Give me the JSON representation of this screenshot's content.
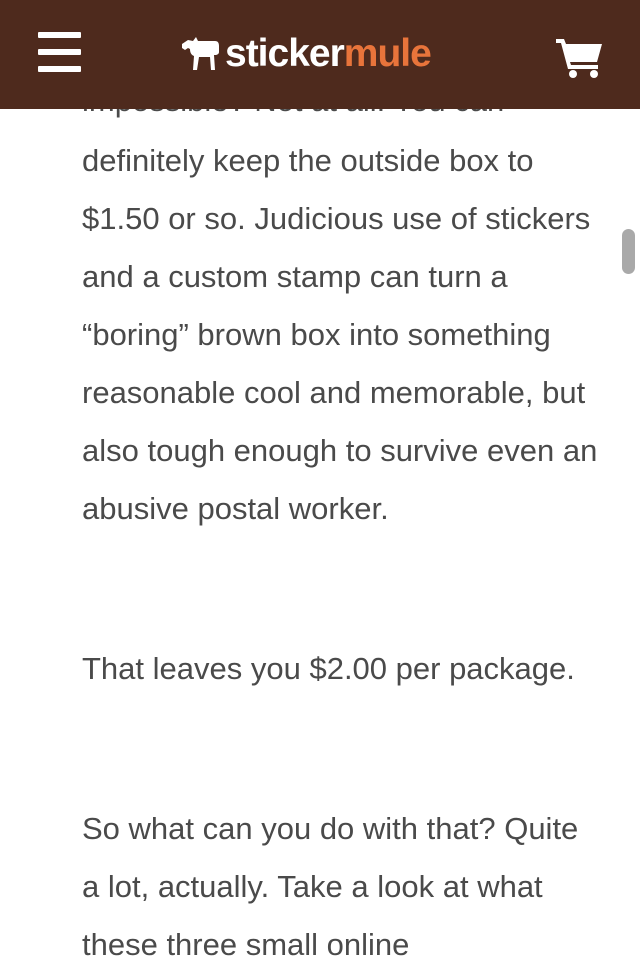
{
  "header": {
    "logo_part1": "sticker",
    "logo_part2": "mule"
  },
  "article": {
    "cut_line": "impossible? Not at all. You can",
    "paragraphs": [
      "definitely keep the outside box to $1.50 or so. Judicious use of stickers and a custom stamp can turn a “boring” brown box into something reasonable cool and memorable, but also tough enough to survive even an abusive postal worker.",
      "That leaves you $2.00 per package.",
      "So what can you do with that? Quite a lot, actually. Take a look at what these three small online"
    ]
  },
  "icons": {
    "menu": "hamburger-menu-icon",
    "logo": "mule-icon",
    "cart": "shopping-cart-icon"
  },
  "colors": {
    "header_bg": "#4e2a1d",
    "brand_orange": "#e8743b",
    "text": "#4a4a4a"
  }
}
